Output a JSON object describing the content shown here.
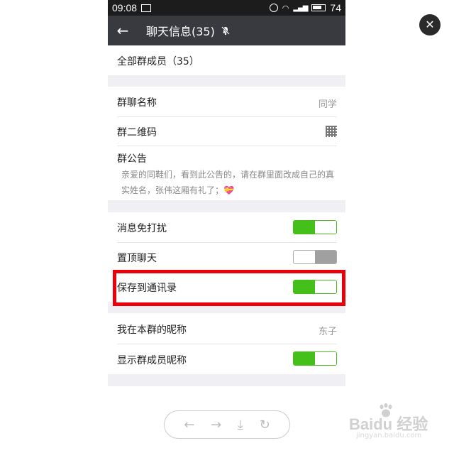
{
  "status_bar": {
    "time": "09:08",
    "battery": "74"
  },
  "title_bar": {
    "back_icon": "arrow-left-icon",
    "title": "聊天信息(35)",
    "mute_icon": "bell-off-icon"
  },
  "members": {
    "label": "全部群成员（35）"
  },
  "group_name": {
    "label": "群聊名称",
    "value": "同学"
  },
  "qr_code": {
    "label": "群二维码"
  },
  "notice": {
    "label": "群公告",
    "text": "亲爱的同鞋们，看到此公告的，请在群里面改成自己的真实姓名，张伟这厢有礼了；💝"
  },
  "settings": {
    "mute": {
      "label": "消息免打扰",
      "on": true
    },
    "pin": {
      "label": "置顶聊天",
      "on": false
    },
    "save_contacts": {
      "label": "保存到通讯录",
      "on": true
    }
  },
  "nickname": {
    "label": "我在本群的昵称",
    "value": "东子"
  },
  "show_nicknames": {
    "label": "显示群成员昵称",
    "on": true
  },
  "nav": {
    "back": "←",
    "forward": "→",
    "download": "⤓",
    "refresh": "↻"
  },
  "watermark": {
    "brand": "Baidu 经验",
    "url": "jingyan.baidu.com"
  },
  "colors": {
    "toggle_on": "#45c01a",
    "toggle_off": "#a0a0a0",
    "title_bar": "#393a3f",
    "highlight": "#e8000b"
  }
}
